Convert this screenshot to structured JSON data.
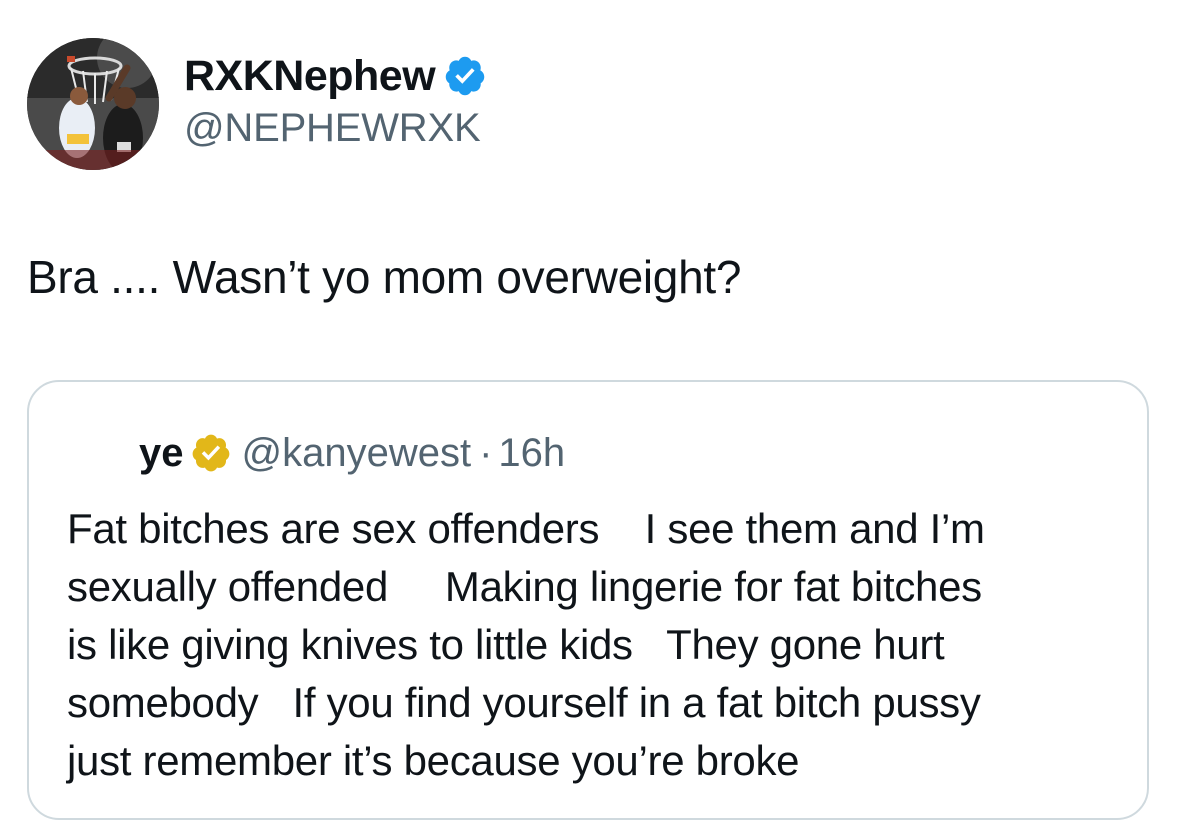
{
  "tweet": {
    "author": {
      "name": "RXKNephew",
      "handle": "@NEPHEWRXK",
      "verified": true,
      "badge_color": "#1d9bf0",
      "avatar": "basketball-dunk-photo"
    },
    "text": "Bra .... Wasn’t yo mom overweight?",
    "quoted": {
      "name": "ye",
      "badge_color": "#e2b719",
      "handle": "@kanyewest",
      "separator": "·",
      "time": "16h",
      "lines": [
        "Fat bitches are sex offenders    I see them and I’m",
        "sexually offended     Making lingerie for fat bitches",
        "is like giving knives to little kids   They gone hurt",
        "somebody   If you find yourself in a fat bitch pussy",
        "just remember it’s because you’re broke"
      ]
    }
  }
}
